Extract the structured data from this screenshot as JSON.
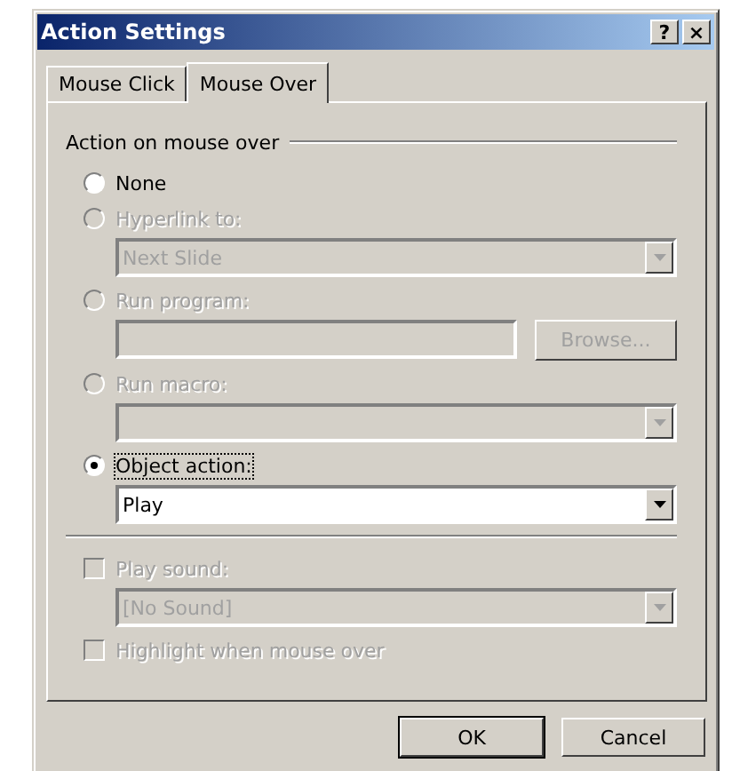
{
  "window": {
    "title": "Action Settings",
    "help": "?",
    "close": "×"
  },
  "tabs": [
    {
      "label": "Mouse Click",
      "selected": false
    },
    {
      "label": "Mouse Over",
      "selected": true
    }
  ],
  "group": {
    "label": "Action on mouse over"
  },
  "options": [
    {
      "label": "None",
      "selected": false,
      "disabled": false
    },
    {
      "label": "Hyperlink to:",
      "selected": false,
      "disabled": true,
      "control": {
        "kind": "combo",
        "value": "Next Slide",
        "disabled": true
      }
    },
    {
      "label": "Run program:",
      "selected": false,
      "disabled": true,
      "control": {
        "kind": "field",
        "disabled": true,
        "button": "Browse..."
      }
    },
    {
      "label": "Run macro:",
      "selected": false,
      "disabled": true,
      "control": {
        "kind": "combo",
        "disabled": true
      }
    },
    {
      "label": "Object action:",
      "selected": true,
      "disabled": false,
      "control": {
        "kind": "combo",
        "value": "Play",
        "disabled": false
      }
    }
  ],
  "sound": {
    "label": "Play sound:",
    "checked": false,
    "disabled": true,
    "value": "[No Sound]"
  },
  "highlight": {
    "label": "Highlight when mouse over",
    "checked": false,
    "disabled": true
  },
  "buttons": [
    "OK",
    "Cancel"
  ]
}
